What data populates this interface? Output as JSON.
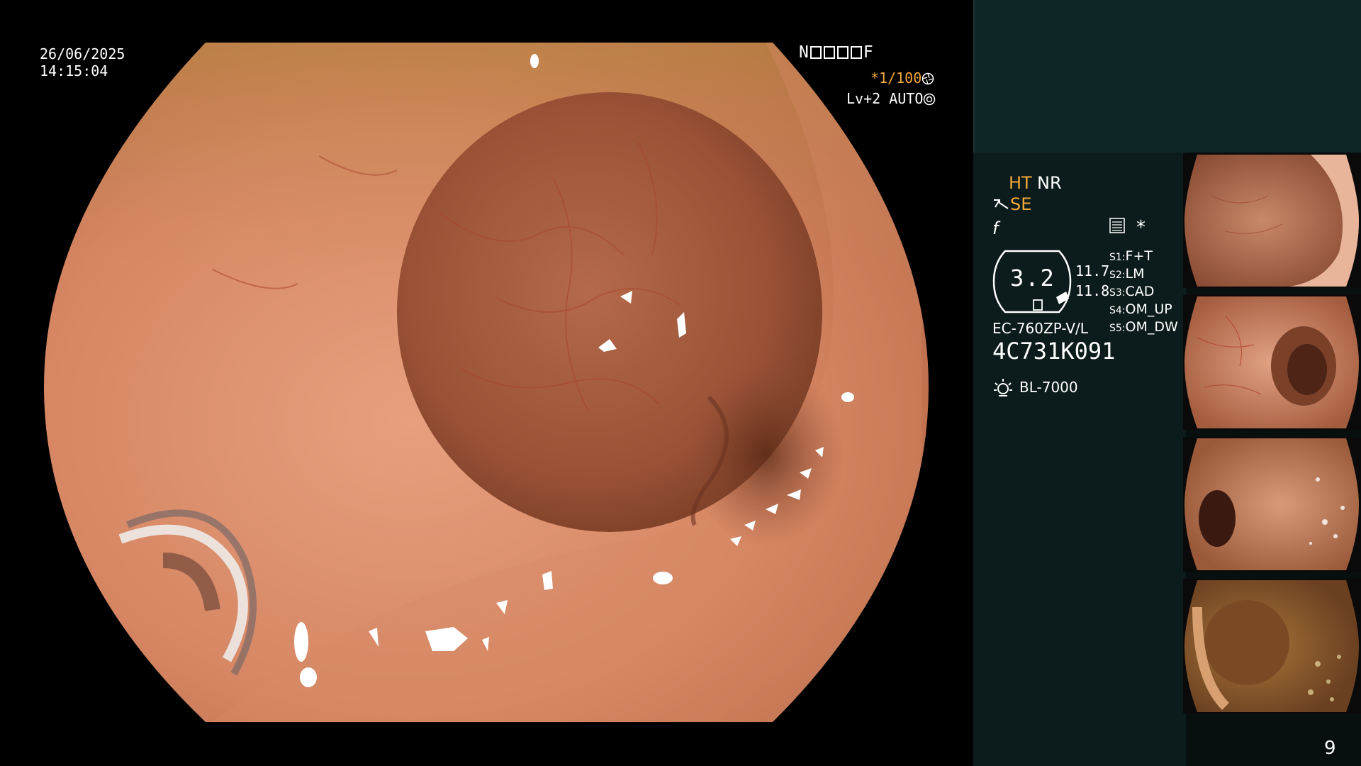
{
  "osd": {
    "date": "26/06/2025",
    "time": "14:15:04",
    "code_prefix": "N",
    "code_suffix": "F",
    "shutter": "*1/100",
    "level": "Lv+2 AUTO"
  },
  "info": {
    "ht": "HT",
    "nr": "NR",
    "se": "SE",
    "f_icon": "f",
    "asterisk": "*",
    "zoom": "3.2",
    "value1": "11.7",
    "value2": "11.8",
    "switches": [
      {
        "key": "S1:",
        "label": "F+T"
      },
      {
        "key": "S2:",
        "label": "LM"
      },
      {
        "key": "S3:",
        "label": "CAD"
      },
      {
        "key": "S4:",
        "label": "OM_UP"
      },
      {
        "key": "S5:",
        "label": "OM_DW"
      }
    ],
    "scope_model": "EC-760ZP-V/L",
    "serial": "4C731K091",
    "light_source": "BL-7000"
  },
  "page_number": "9",
  "colors": {
    "accent_orange": "#f2a83a",
    "panel_top": "#0f2626",
    "panel_bg": "#070f0f",
    "mucosa": "#d98a6a"
  },
  "icons": {
    "shutter": "aperture-icon",
    "level": "iris-icon",
    "se": "stylus-icon",
    "menu": "settings-list-icon",
    "light": "lamp-icon"
  }
}
